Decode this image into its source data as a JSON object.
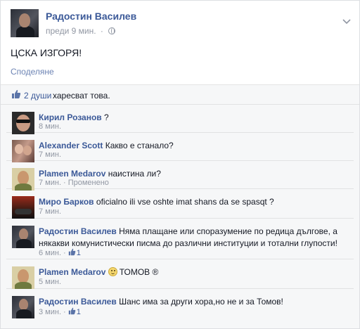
{
  "post": {
    "author": "Радостин Василев",
    "time": "преди 9 мин.",
    "dot": "·",
    "text": "ЦСКА ИЗГОРЯ!",
    "share_label": "Споделяне",
    "likes_link": "2 души",
    "likes_rest": "харесват това."
  },
  "comments": [
    {
      "name": "Кирил Розанов",
      "text": "?",
      "time": "8 мин.",
      "avatar": "avatar-kiril"
    },
    {
      "name": "Alexander Scott",
      "text": "Какво е станало?",
      "time": "7 мин.",
      "avatar": "avatar-alexander"
    },
    {
      "name": "Plamen Medarov",
      "text": "наистина ли?",
      "time": "7 мин.",
      "edited": "Променено",
      "avatar": "avatar-plamen"
    },
    {
      "name": "Миро Барков",
      "text": "oficialno ili vse oshte imat shans da se spasqt ?",
      "time": "7 мин.",
      "avatar": "avatar-miro"
    },
    {
      "name": "Радостин Василев",
      "text": "Няма плащане или споразумение по редица дългове, а някакви комунистически писма до различни институции и тотални глупости!",
      "time": "6 мин.",
      "likes": "1",
      "avatar": "avatar-radostin"
    },
    {
      "name": "Plamen Medarov",
      "text": "ТОМОВ ®",
      "time": "5 мин.",
      "avatar": "avatar-plamen"
    },
    {
      "name": "Радостин Василев",
      "text": "Шанс има за други хора,но не и за Томов!",
      "time": "3 мин.",
      "likes": "1",
      "avatar": "avatar-radostin"
    }
  ],
  "colors": {
    "link": "#3b5998",
    "meta": "#9197a3",
    "bg_comments": "#f6f7f8"
  },
  "icons": [
    "chevron-down-icon",
    "globe-icon",
    "like-icon",
    "smile-icon"
  ]
}
